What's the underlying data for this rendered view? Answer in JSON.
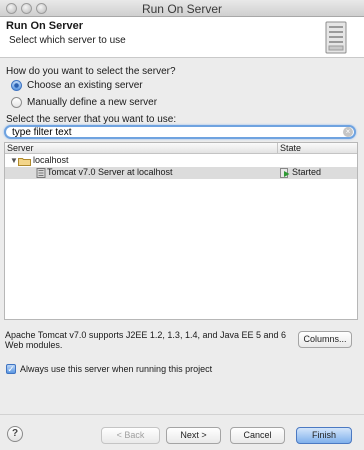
{
  "window": {
    "title": "Run On Server"
  },
  "header": {
    "title": "Run On Server",
    "subtitle": "Select which server to use"
  },
  "selection": {
    "prompt": "How do you want to select the server?",
    "options": [
      "Choose an existing server",
      "Manually define a new server"
    ],
    "selected_option": "Choose an existing server"
  },
  "filter": {
    "label": "Select the server that you want to use:",
    "value": "type filter text"
  },
  "tree": {
    "columns": [
      "Server",
      "State"
    ],
    "group": "localhost",
    "servers": [
      {
        "name": "Tomcat v7.0 Server at localhost",
        "state": "Started"
      }
    ]
  },
  "description": "Apache Tomcat v7.0 supports J2EE 1.2, 1.3, 1.4, and Java EE 5 and 6 Web modules.",
  "buttons": {
    "columns": "Columns...",
    "help": "?",
    "back": "< Back",
    "next": "Next >",
    "cancel": "Cancel",
    "finish": "Finish"
  },
  "always_use": {
    "label": "Always use this server when running this project",
    "checked": true
  },
  "icons": {
    "window_controls": [
      "close-icon",
      "minimize-icon",
      "zoom-icon"
    ],
    "header": "server-graphic-icon",
    "folder": "folder-icon",
    "server": "tomcat-server-icon",
    "state": "started-state-icon"
  },
  "colors": {
    "accent": "#5b97e2",
    "selected_row": "#dcdcdc",
    "state_green": "#2f9a35"
  }
}
